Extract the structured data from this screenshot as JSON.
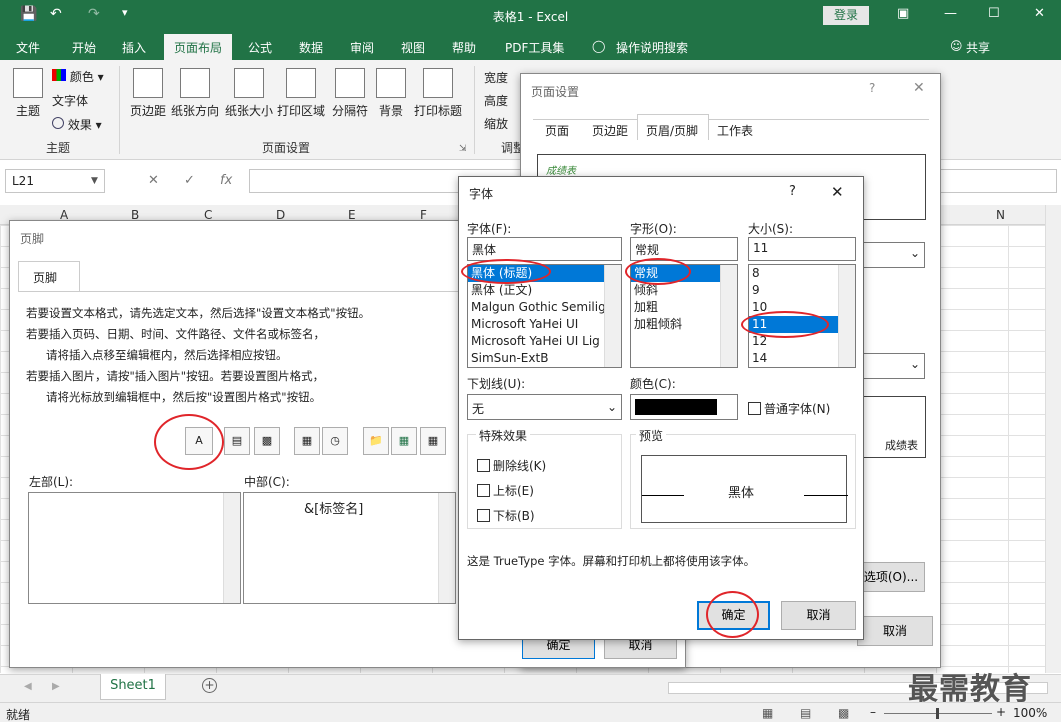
{
  "window": {
    "title": "表格1 - Excel",
    "login": "登录"
  },
  "tabs": [
    "文件",
    "开始",
    "插入",
    "页面布局",
    "公式",
    "数据",
    "审阅",
    "视图",
    "帮助",
    "PDF工具集"
  ],
  "tell_me": "操作说明搜索",
  "share": "共享",
  "ribbon": {
    "theme_group": {
      "theme": "主题",
      "colors": "颜色",
      "fonts": "文字体",
      "effects": "效果",
      "label": "主题"
    },
    "page_setup": {
      "margins": "页边距",
      "orientation": "纸张方向",
      "size": "纸张大小",
      "print_area": "打印区域",
      "breaks": "分隔符",
      "background": "背景",
      "print_titles": "打印标题",
      "label": "页面设置"
    },
    "scale": {
      "width": "宽度",
      "height": "高度",
      "scale": "缩放",
      "label": "调整"
    }
  },
  "namebox": "L21",
  "fx": "fx",
  "columns": [
    "A",
    "B",
    "C",
    "D",
    "E",
    "F",
    "N"
  ],
  "page_setup_dialog": {
    "title": "页面设置",
    "tabs": [
      "页面",
      "页边距",
      "页眉/页脚",
      "工作表"
    ],
    "header_preview": "成绩表",
    "footer_preview": "成绩表",
    "options_btn": "选项(O)...",
    "cancel": "取消"
  },
  "footer_dialog": {
    "title": "页脚",
    "tab": "页脚",
    "instructions": [
      "若要设置文本格式，请先选定文本，然后选择\"设置文本格式\"按钮。",
      "若要插入页码、日期、时间、文件路径、文件名或标签名，",
      "请将插入点移至编辑框内，然后选择相应按钮。",
      "若要插入图片，请按\"插入图片\"按钮。若要设置图片格式，",
      "请将光标放到编辑框中，然后按\"设置图片格式\"按钮。"
    ],
    "format_text_btn": "A",
    "left_label": "左部(L):",
    "center_label": "中部(C):",
    "center_value": "&[标签名]",
    "ok": "确定",
    "cancel": "取消"
  },
  "font_dialog": {
    "title": "字体",
    "help": "?",
    "font_label": "字体(F):",
    "font_value": "黑体",
    "fonts": [
      "黑体 (标题)",
      "黑体 (正文)",
      "Malgun Gothic Semilig",
      "Microsoft YaHei UI",
      "Microsoft YaHei UI Lig",
      "SimSun-ExtB"
    ],
    "style_label": "字形(O):",
    "style_value": "常规",
    "styles": [
      "常规",
      "倾斜",
      "加粗",
      "加粗倾斜"
    ],
    "size_label": "大小(S):",
    "size_value": "11",
    "sizes": [
      "8",
      "9",
      "10",
      "11",
      "12",
      "14"
    ],
    "underline_label": "下划线(U):",
    "underline_value": "无",
    "color_label": "颜色(C):",
    "color_value": "#000000",
    "normal_font": "普通字体(N)",
    "effects_label": "特殊效果",
    "strike": "删除线(K)",
    "superscript": "上标(E)",
    "subscript": "下标(B)",
    "preview_label": "预览",
    "preview_text": "黑体",
    "note": "这是 TrueType 字体。屏幕和打印机上都将使用该字体。",
    "ok": "确定",
    "cancel": "取消"
  },
  "sheet_tab": "Sheet1",
  "status": {
    "ready": "就绪",
    "zoom": "100%"
  },
  "watermark": "最需教育"
}
